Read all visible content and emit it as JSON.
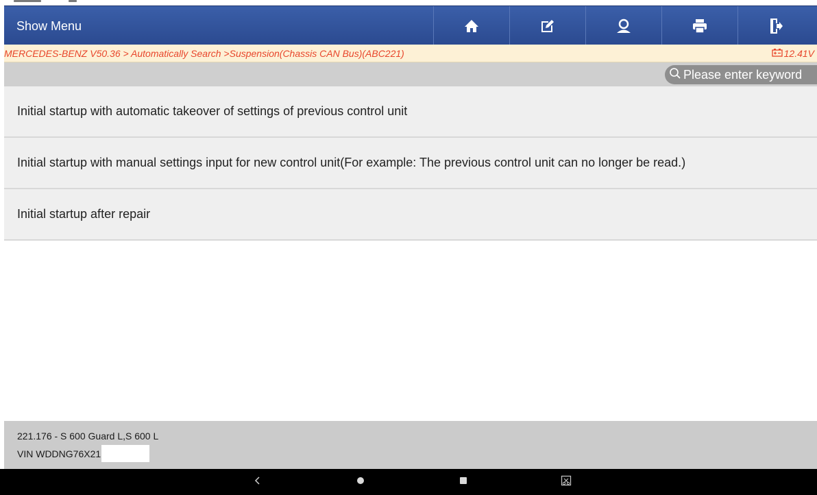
{
  "topbar": {
    "title": "Show Menu",
    "buttons": [
      {
        "name": "home-button",
        "icon": "home-icon"
      },
      {
        "name": "edit-button",
        "icon": "edit-icon"
      },
      {
        "name": "support-button",
        "icon": "support-icon"
      },
      {
        "name": "print-button",
        "icon": "printer-icon"
      },
      {
        "name": "exit-button",
        "icon": "exit-icon"
      }
    ]
  },
  "breadcrumb": {
    "path": "MERCEDES-BENZ V50.36 > Automatically Search >Suspension(Chassis CAN Bus)(ABC221)",
    "voltage": "12.41V"
  },
  "search": {
    "placeholder": "Please enter keyword"
  },
  "menu_items": [
    {
      "label": "Initial startup with automatic takeover of settings of previous control unit"
    },
    {
      "label": "Initial startup with manual settings input for new control unit(For example: The previous control unit can no longer be read.)"
    },
    {
      "label": "Initial startup after repair"
    }
  ],
  "footer": {
    "model": "221.176 - S 600 Guard L,S 600 L",
    "vin": "VIN WDDNG76X21"
  },
  "colors": {
    "header_blue": "#2f4f98",
    "breadcrumb_text": "#e8452b",
    "breadcrumb_bg": "#fdf1d6"
  }
}
